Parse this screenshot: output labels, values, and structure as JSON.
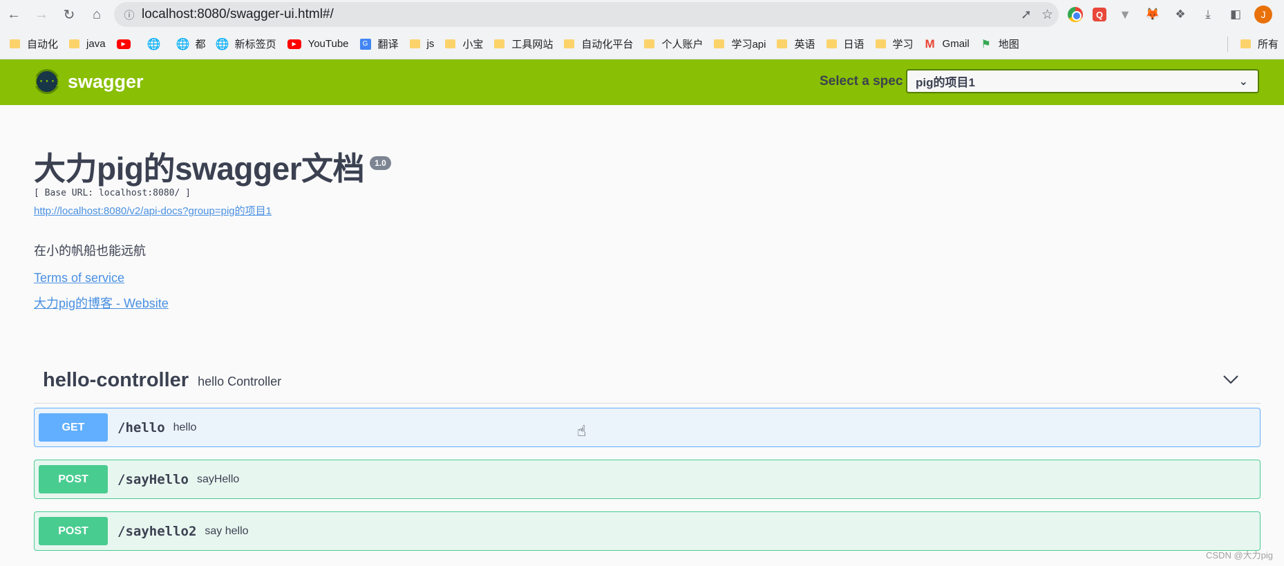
{
  "browser": {
    "url": "localhost:8080/swagger-ui.html#/",
    "profile_initial": "J",
    "bookmarks": [
      {
        "icon": "folder",
        "label": "自动化"
      },
      {
        "icon": "folder",
        "label": "java"
      },
      {
        "icon": "youtube",
        "label": ""
      },
      {
        "icon": "globe",
        "label": ""
      },
      {
        "icon": "globe",
        "label": "都"
      },
      {
        "icon": "globe",
        "label": "新标签页"
      },
      {
        "icon": "youtube",
        "label": "YouTube"
      },
      {
        "icon": "google-translate",
        "label": "翻译"
      },
      {
        "icon": "folder",
        "label": "js"
      },
      {
        "icon": "folder",
        "label": "小宝"
      },
      {
        "icon": "folder",
        "label": "工具网站"
      },
      {
        "icon": "folder",
        "label": "自动化平台"
      },
      {
        "icon": "folder",
        "label": "个人账户"
      },
      {
        "icon": "folder",
        "label": "学习api"
      },
      {
        "icon": "folder",
        "label": "英语"
      },
      {
        "icon": "folder",
        "label": "日语"
      },
      {
        "icon": "folder",
        "label": "学习"
      },
      {
        "icon": "gmail",
        "label": "Gmail"
      },
      {
        "icon": "maps",
        "label": "地图"
      }
    ],
    "other_bookmarks": "所有"
  },
  "topbar": {
    "logo_text": "swagger",
    "logo_mark": "{···}",
    "spec_label": "Select a spec",
    "spec_value": "pig的项目1",
    "color": "#89bf04"
  },
  "info": {
    "title": "大力pig的swagger文档",
    "version": "1.0",
    "base_url": "[ Base URL: localhost:8080/ ]",
    "api_docs_link": "http://localhost:8080/v2/api-docs?group=pig的项目1",
    "description": "在小的帆船也能远航",
    "terms_link": "Terms of service",
    "website_link": "大力pig的博客 - Website"
  },
  "controller": {
    "name": "hello-controller",
    "description": "hello Controller",
    "operations": [
      {
        "method": "GET",
        "path": "/hello",
        "summary": "hello"
      },
      {
        "method": "POST",
        "path": "/sayHello",
        "summary": "sayHello"
      },
      {
        "method": "POST",
        "path": "/sayhello2",
        "summary": "say hello"
      }
    ]
  },
  "watermark": "CSDN @大力pig"
}
